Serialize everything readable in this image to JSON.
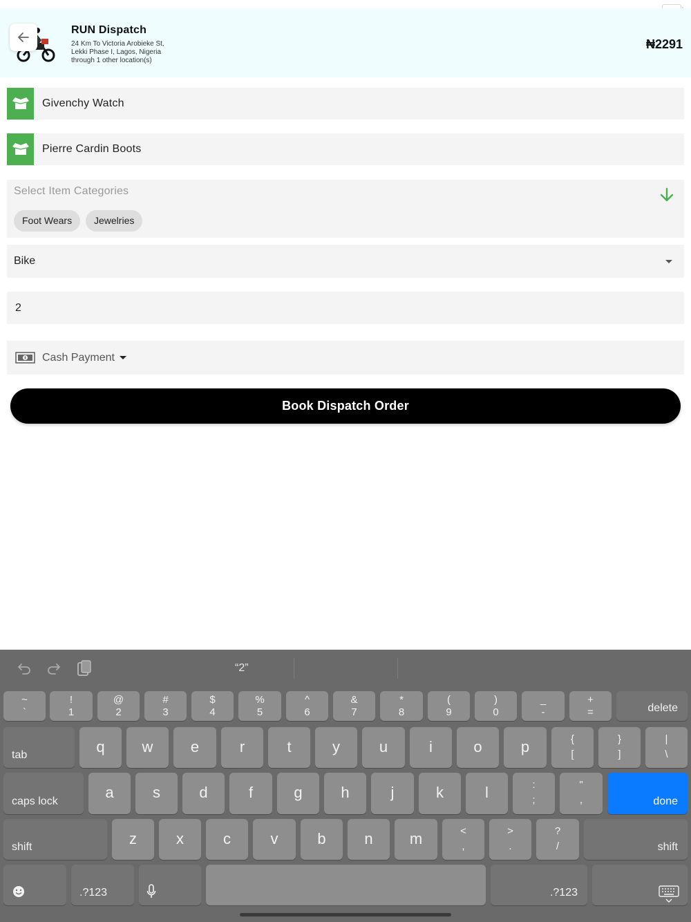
{
  "header": {
    "title": "RUN Dispatch",
    "address_line1": "24 Km To Victoria Arobieke St,",
    "address_line2": "Lekki Phase I, Lagos, Nigeria",
    "address_line3": "through 1 other location(s)",
    "price": "₦2291"
  },
  "items": [
    {
      "label": "Givenchy Watch"
    },
    {
      "label": "Pierre Cardin Boots"
    }
  ],
  "categories": {
    "placeholder": "Select Item Categories",
    "chips": [
      "Foot Wears",
      "Jewelries"
    ]
  },
  "vehicle": {
    "selected": "Bike"
  },
  "quantity": {
    "value": "2"
  },
  "payment": {
    "selected": "Cash Payment"
  },
  "book_button": "Book Dispatch Order",
  "colors": {
    "accent_green": "#4cb050",
    "keyboard_done": "#0a7aff",
    "header_bg": "#effdff"
  },
  "keyboard": {
    "suggestion": "“2”",
    "number_row": [
      {
        "top": "~",
        "bottom": "`"
      },
      {
        "top": "!",
        "bottom": "1"
      },
      {
        "top": "@",
        "bottom": "2"
      },
      {
        "top": "#",
        "bottom": "3"
      },
      {
        "top": "$",
        "bottom": "4"
      },
      {
        "top": "%",
        "bottom": "5"
      },
      {
        "top": "^",
        "bottom": "6"
      },
      {
        "top": "&",
        "bottom": "7"
      },
      {
        "top": "*",
        "bottom": "8"
      },
      {
        "top": "(",
        "bottom": "9"
      },
      {
        "top": ")",
        "bottom": "0"
      },
      {
        "top": "_",
        "bottom": "-"
      },
      {
        "top": "+",
        "bottom": "="
      }
    ],
    "delete": "delete",
    "tab": "tab",
    "row_q": [
      "q",
      "w",
      "e",
      "r",
      "t",
      "y",
      "u",
      "i",
      "o",
      "p"
    ],
    "row_q_symbols": [
      {
        "top": "{",
        "bottom": "["
      },
      {
        "top": "}",
        "bottom": "]"
      },
      {
        "top": "|",
        "bottom": "\\"
      }
    ],
    "caps_lock": "caps lock",
    "row_a": [
      "a",
      "s",
      "d",
      "f",
      "g",
      "h",
      "j",
      "k",
      "l"
    ],
    "row_a_symbols": [
      {
        "top": ":",
        "bottom": ";"
      },
      {
        "top": "\"",
        "bottom": ","
      }
    ],
    "done": "done",
    "shift": "shift",
    "row_z": [
      "z",
      "x",
      "c",
      "v",
      "b",
      "n",
      "m"
    ],
    "row_z_symbols": [
      {
        "top": "<",
        "bottom": ","
      },
      {
        "top": ">",
        "bottom": "."
      },
      {
        "top": "?",
        "bottom": "/"
      }
    ],
    "numbers_key": ".?123"
  }
}
